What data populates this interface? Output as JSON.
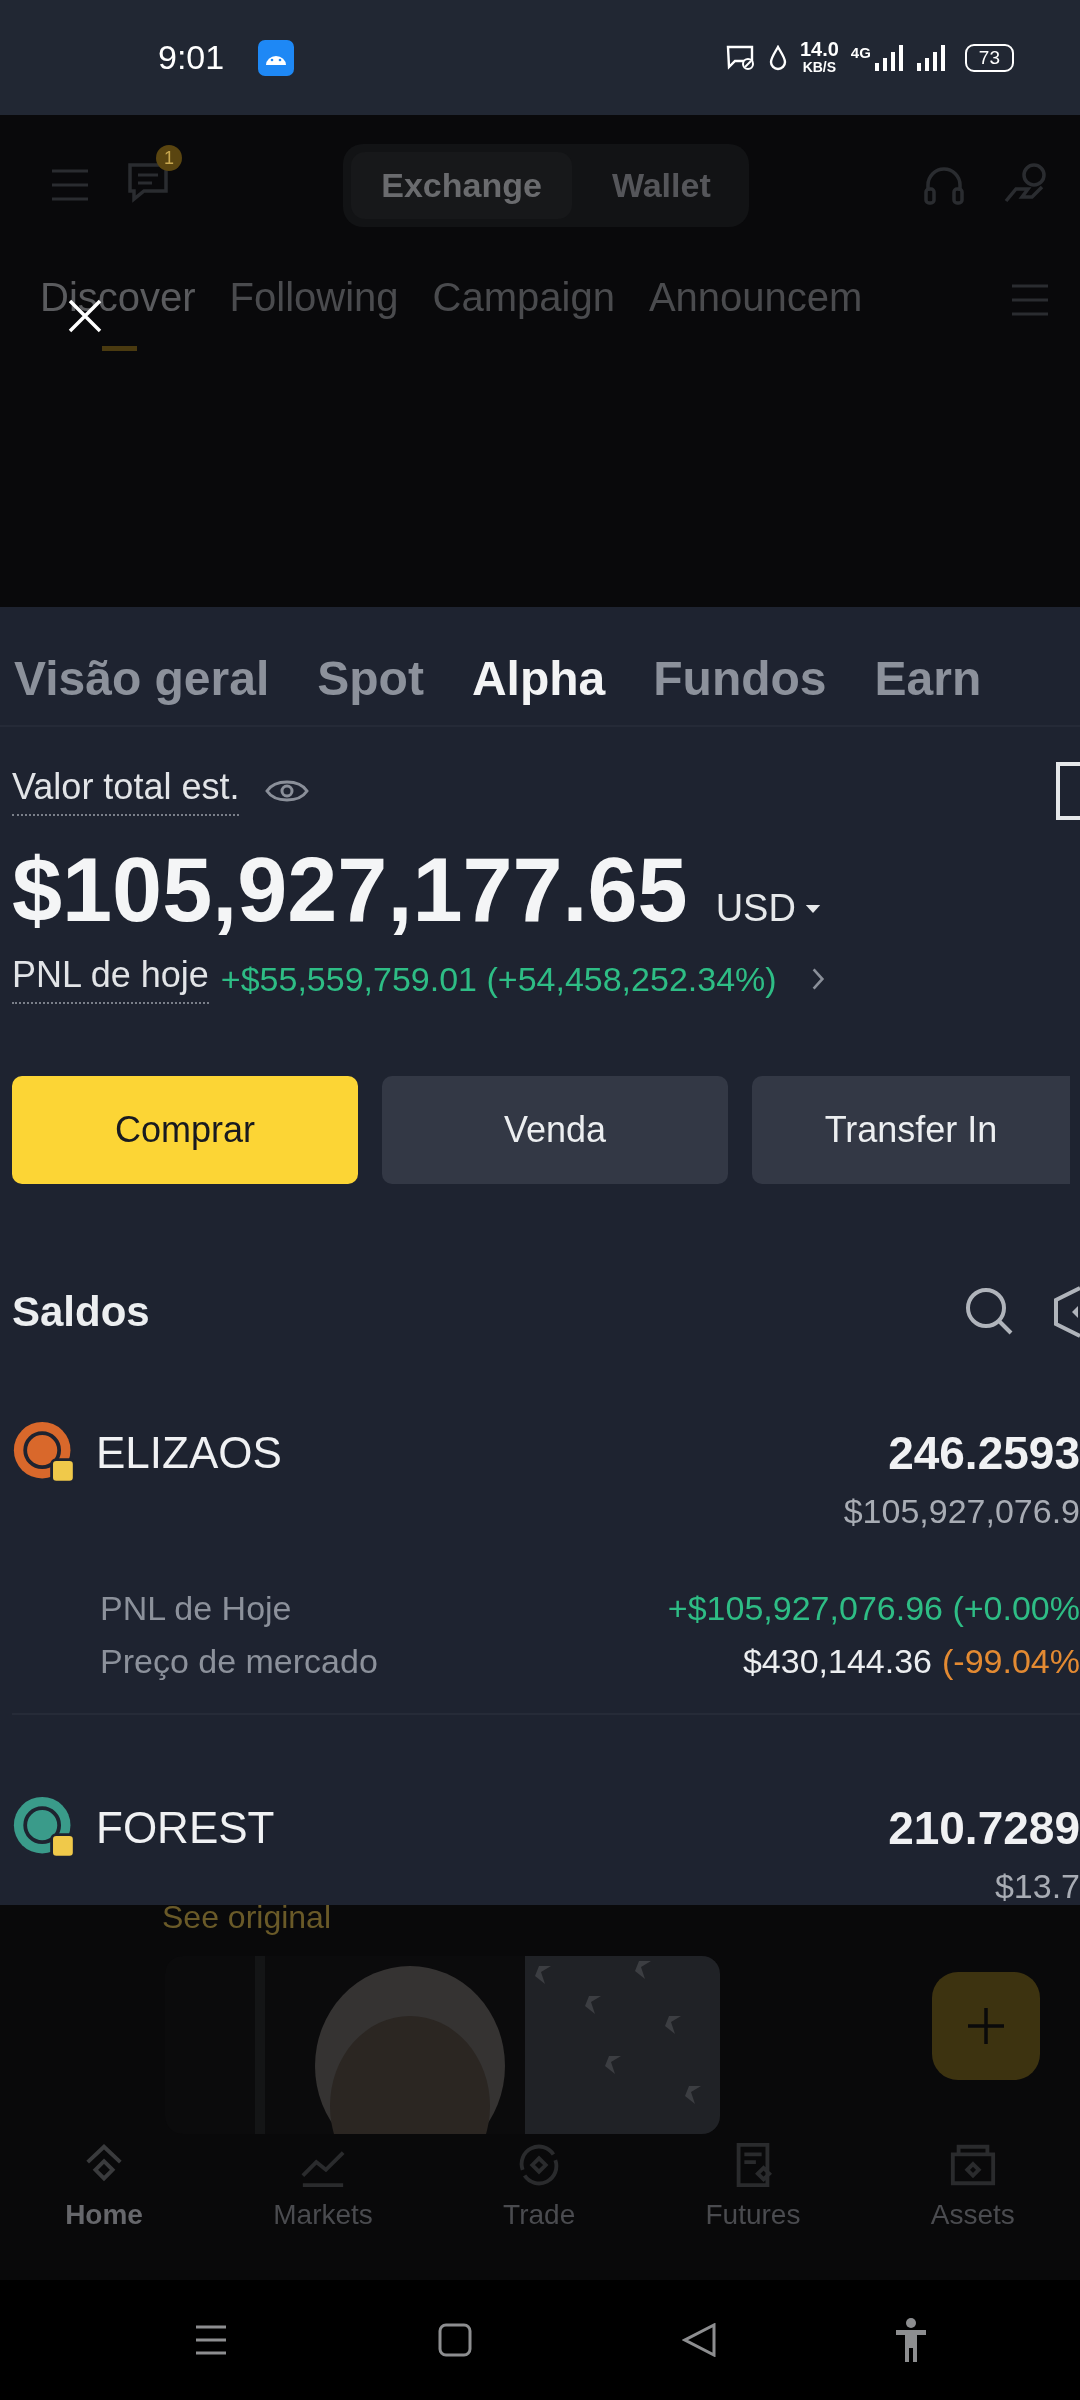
{
  "status_bar": {
    "time": "9:01",
    "speed": "14.0",
    "speed_unit": "KB/S",
    "network": "4G",
    "battery": "73"
  },
  "background_app": {
    "chat_badge": "1",
    "segments": [
      {
        "label": "Exchange",
        "selected": true
      },
      {
        "label": "Wallet",
        "selected": false
      }
    ],
    "tabs": [
      {
        "label": "Discover",
        "selected": true
      },
      {
        "label": "Following",
        "selected": false
      },
      {
        "label": "Campaign",
        "selected": false
      },
      {
        "label": "Announcem",
        "selected": false
      }
    ]
  },
  "viewer": {
    "tabs": [
      {
        "label": "Visão geral",
        "selected": false
      },
      {
        "label": "Spot",
        "selected": false
      },
      {
        "label": "Alpha",
        "selected": true
      },
      {
        "label": "Fundos",
        "selected": false
      },
      {
        "label": "Earn",
        "selected": false
      }
    ],
    "total_label": "Valor total est.",
    "total_value": "$105,927,177.65",
    "currency": "USD",
    "pnl_label": "PNL de hoje",
    "pnl_value": "+$55,559,759.01 (+54,458,252.34%)",
    "buttons": [
      {
        "label": "Comprar",
        "kind": "primary"
      },
      {
        "label": "Venda",
        "kind": "secondary"
      },
      {
        "label": "Transfer In",
        "kind": "secondary"
      }
    ],
    "balances_title": "Saldos",
    "assets": [
      {
        "symbol": "ELIZAOS",
        "color": "#d9682b",
        "amount": "246.2593",
        "value": "$105,927,076.9",
        "pnl_label": "PNL de Hoje",
        "pnl_value": "+$105,927,076.96 (+0.00%",
        "price_label": "Preço de mercado",
        "price": "$430,144.36",
        "price_change": "(-99.04%"
      },
      {
        "symbol": "FOREST",
        "color": "#3a9b8a",
        "amount": "210.7289",
        "value": "$13.7"
      }
    ]
  },
  "feed": {
    "see_original": "See original"
  },
  "bottom_nav": [
    {
      "label": "Home",
      "selected": true
    },
    {
      "label": "Markets",
      "selected": false
    },
    {
      "label": "Trade",
      "selected": false
    },
    {
      "label": "Futures",
      "selected": false
    },
    {
      "label": "Assets",
      "selected": false
    }
  ]
}
